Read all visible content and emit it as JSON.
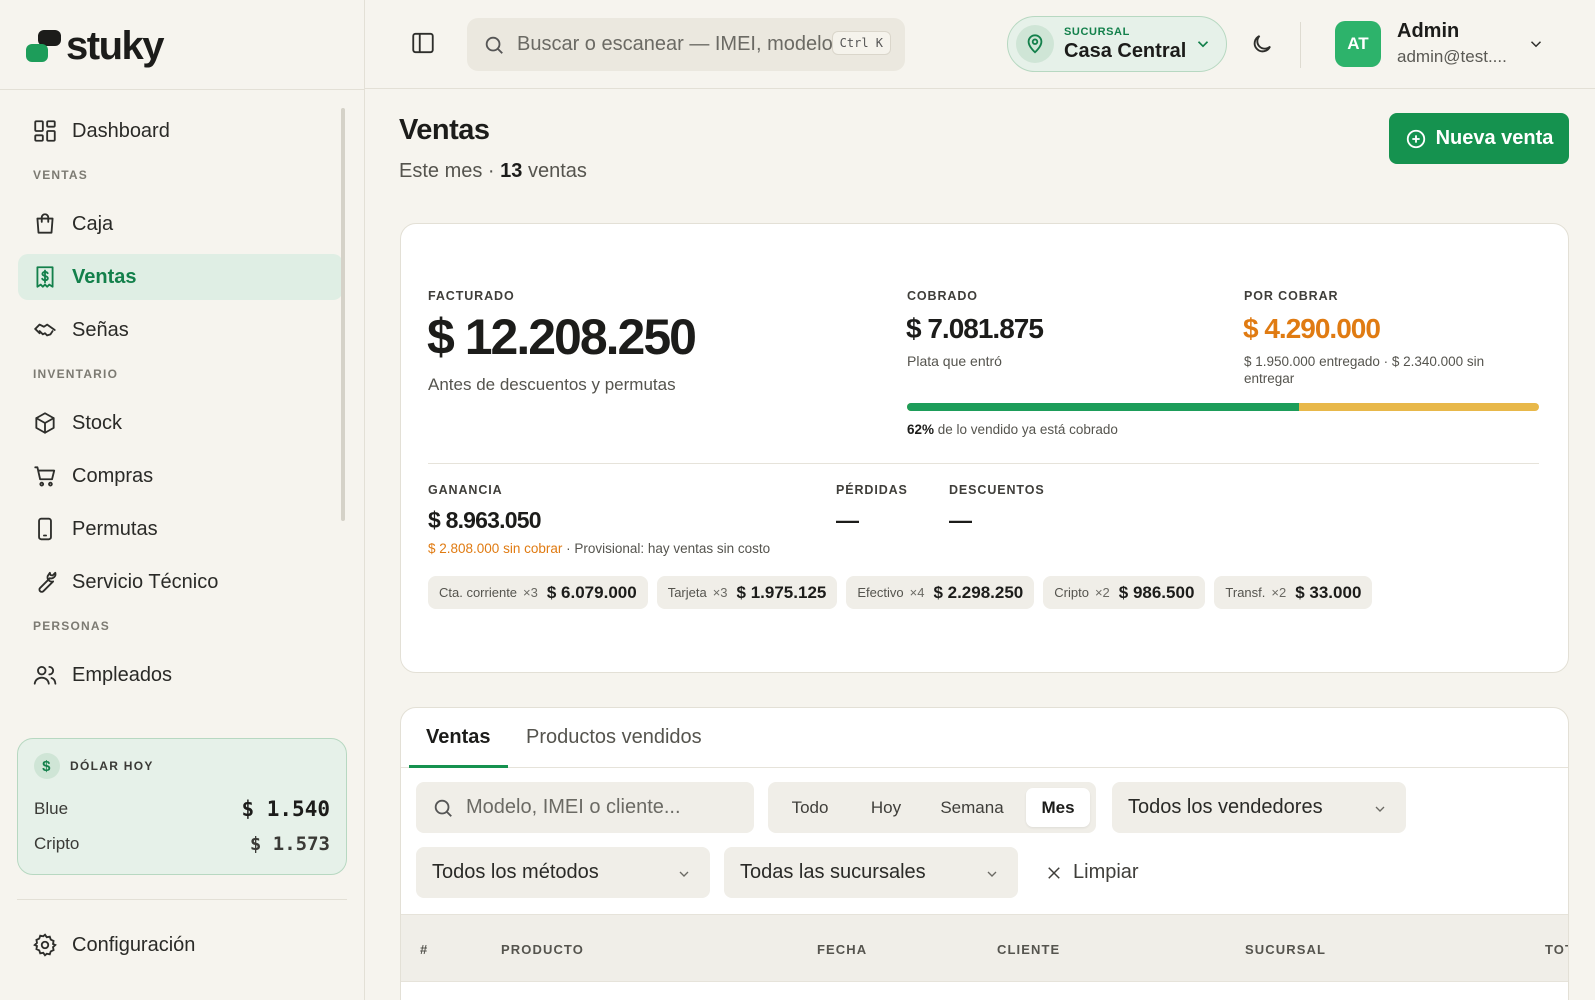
{
  "brand": {
    "name": "stuky",
    "accent": "#15924f",
    "dark": "#1c1c1a"
  },
  "sidebar": {
    "items": [
      {
        "key": "dashboard",
        "label": "Dashboard",
        "icon": "dashboard-icon"
      },
      {
        "section": "VENTAS"
      },
      {
        "key": "caja",
        "label": "Caja",
        "icon": "shopping-bag-icon"
      },
      {
        "key": "ventas",
        "label": "Ventas",
        "icon": "receipt-dollar-icon",
        "active": true
      },
      {
        "key": "senas",
        "label": "Señas",
        "icon": "handshake-icon"
      },
      {
        "section": "INVENTARIO"
      },
      {
        "key": "stock",
        "label": "Stock",
        "icon": "box-icon"
      },
      {
        "key": "compras",
        "label": "Compras",
        "icon": "cart-icon"
      },
      {
        "key": "permutas",
        "label": "Permutas",
        "icon": "phone-icon"
      },
      {
        "key": "servicio",
        "label": "Servicio Técnico",
        "icon": "wrench-icon"
      },
      {
        "section": "PERSONAS"
      },
      {
        "key": "empleados",
        "label": "Empleados",
        "icon": "users-icon"
      }
    ],
    "dolar": {
      "title": "DÓLAR HOY",
      "blue_label": "Blue",
      "blue_value": "$ 1.540",
      "cripto_label": "Cripto",
      "cripto_value": "$ 1.573"
    },
    "config_label": "Configuración"
  },
  "topbar": {
    "search_placeholder": "Buscar o escanear — IMEI, modelo, cliente",
    "search_shortcut": "Ctrl K",
    "branch_label": "SUCURSAL",
    "branch_name": "Casa Central",
    "user_initials": "AT",
    "user_name": "Admin",
    "user_email": "admin@test...."
  },
  "page": {
    "title": "Ventas",
    "subtitle_prefix": "Este mes · ",
    "subtitle_count": "13",
    "subtitle_suffix": " ventas",
    "new_button": "Nueva venta"
  },
  "summary": {
    "facturado_label": "FACTURADO",
    "facturado_value": "$ 12.208.250",
    "facturado_note": "Antes de descuentos y permutas",
    "cobrado_label": "COBRADO",
    "cobrado_value": "$ 7.081.875",
    "cobrado_note": "Plata que entró",
    "por_cobrar_label": "POR COBRAR",
    "por_cobrar_value": "$ 4.290.000",
    "por_cobrar_note": "$ 1.950.000 entregado · $ 2.340.000 sin entregar",
    "cobrado_pct": 62,
    "cobrado_pct_label": "62%",
    "cobrado_pct_text": " de lo vendido ya está cobrado",
    "ganancia_label": "GANANCIA",
    "ganancia_value": "$ 8.963.050",
    "ganancia_pending": "$ 2.808.000 sin cobrar",
    "ganancia_note": " · Provisional: hay ventas sin costo",
    "perdidas_label": "PÉRDIDAS",
    "perdidas_value": "—",
    "descuentos_label": "DESCUENTOS",
    "descuentos_value": "—",
    "colors": {
      "green": "#1d9d5a",
      "orange": "#e07b12",
      "yellow": "#e8b84a"
    },
    "methods": [
      {
        "name": "Cta. corriente",
        "count": "×3",
        "amount": "$ 6.079.000"
      },
      {
        "name": "Tarjeta",
        "count": "×3",
        "amount": "$ 1.975.125"
      },
      {
        "name": "Efectivo",
        "count": "×4",
        "amount": "$ 2.298.250"
      },
      {
        "name": "Cripto",
        "count": "×2",
        "amount": "$ 986.500"
      },
      {
        "name": "Transf.",
        "count": "×2",
        "amount": "$ 33.000"
      }
    ]
  },
  "list": {
    "tabs": [
      "Ventas",
      "Productos vendidos"
    ],
    "search_placeholder": "Modelo, IMEI o cliente...",
    "ranges": [
      "Todo",
      "Hoy",
      "Semana",
      "Mes"
    ],
    "active_range": "Mes",
    "seller_select": "Todos los vendedores",
    "method_select": "Todos los métodos",
    "branch_select": "Todas las sucursales",
    "clear_label": "Limpiar",
    "columns": [
      "#",
      "PRODUCTO",
      "FECHA",
      "CLIENTE",
      "SUCURSAL",
      "TOTAL"
    ]
  }
}
